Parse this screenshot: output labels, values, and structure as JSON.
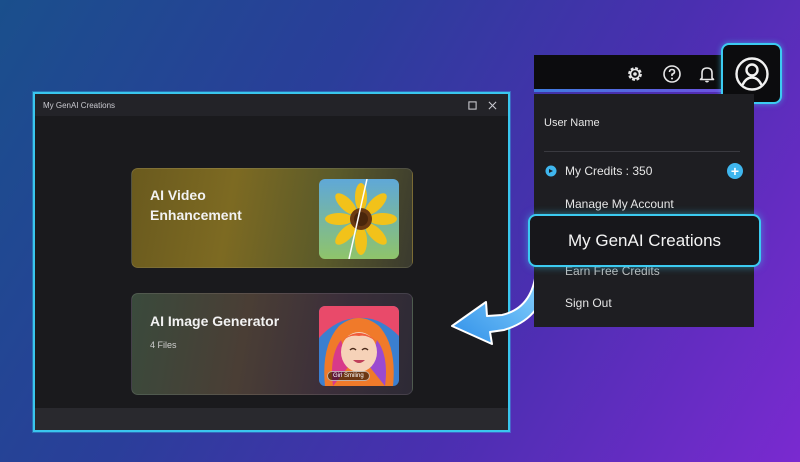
{
  "window": {
    "title": "My GenAI Creations",
    "maximize_icon": "maximize-icon",
    "close_icon": "close-icon"
  },
  "cards": [
    {
      "title": "AI Video Enhancement",
      "thumb": "sunflower-image"
    },
    {
      "title": "AI Image Generator",
      "subtitle": "4 Files",
      "thumb": "anime-portrait-image",
      "thumb_badge": "Girl Smiling"
    }
  ],
  "topbar": {
    "icons": [
      "settings-icon",
      "help-icon",
      "bell-icon",
      "user-avatar-icon"
    ]
  },
  "menu": {
    "user_name": "User Name",
    "credits": "My Credits : 350",
    "add_credits": "+",
    "manage": "Manage My Account",
    "creations": "My GenAI Creations",
    "earn": "Earn Free Credits",
    "sign_out": "Sign Out"
  },
  "colors": {
    "accent": "#3ccbf1",
    "window_bg": "#1c1c20",
    "menu_bg": "#1e1e22"
  }
}
